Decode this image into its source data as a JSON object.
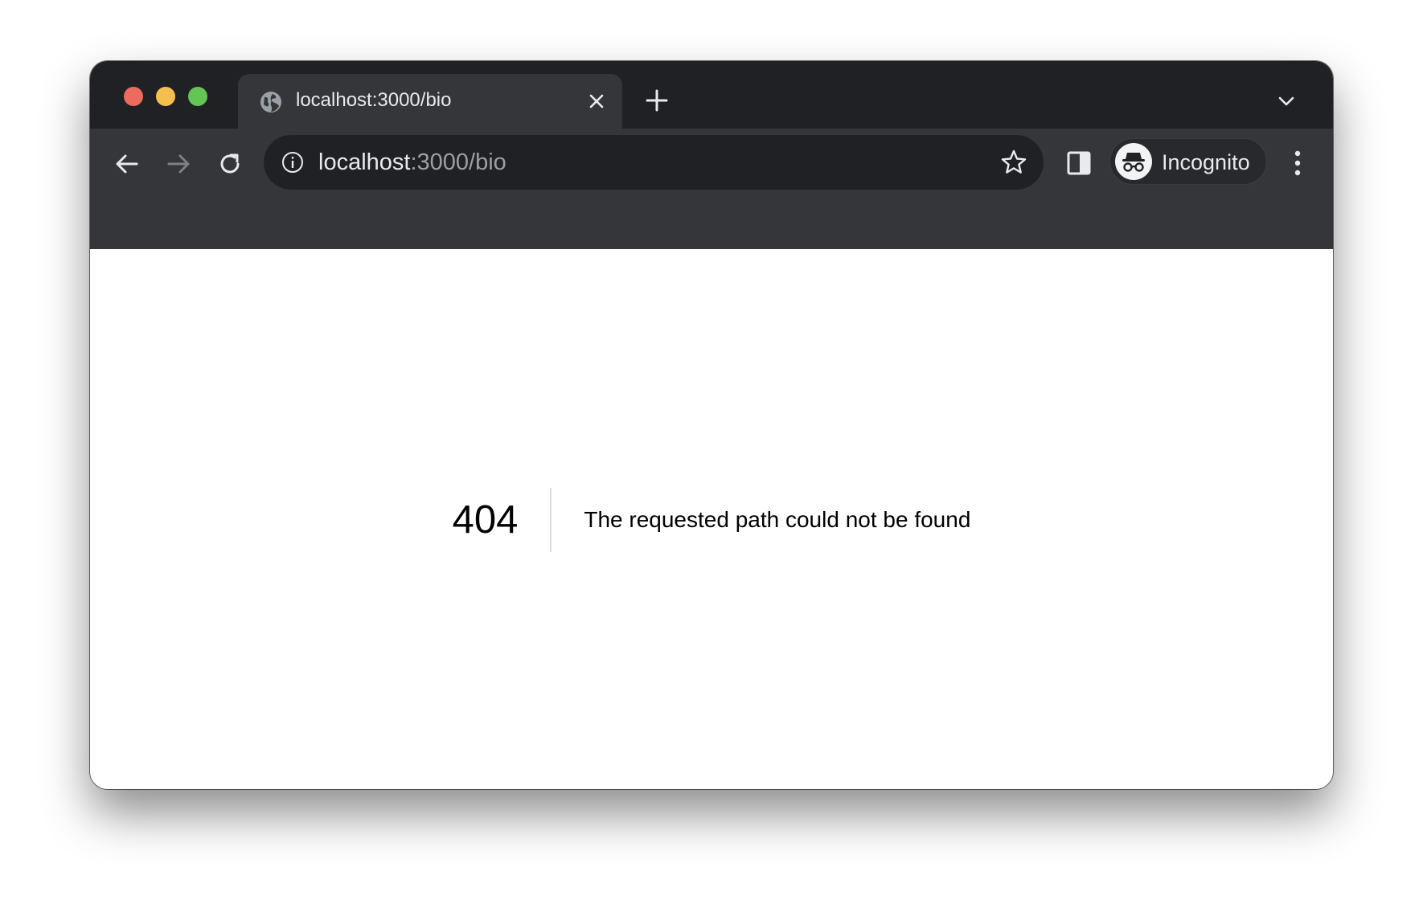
{
  "browser": {
    "tab": {
      "title": "localhost:3000/bio",
      "favicon": "globe-icon"
    },
    "omnibox": {
      "url_host": "localhost",
      "url_path": ":3000/bio"
    },
    "profile": {
      "label": "Incognito",
      "icon": "incognito-icon"
    },
    "colors": {
      "tabstrip": "#202124",
      "toolbar": "#35363a",
      "omnibox": "#202124",
      "text": "#e8eaed",
      "muted": "#9aa0a6"
    }
  },
  "page": {
    "error_code": "404",
    "error_message": "The requested path could not be found"
  }
}
